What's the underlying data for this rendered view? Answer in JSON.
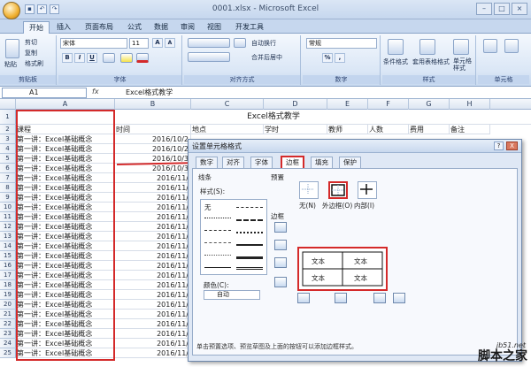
{
  "window": {
    "title": "0001.xlsx - Microsoft Excel"
  },
  "ribbon_tabs": [
    "开始",
    "插入",
    "页面布局",
    "公式",
    "数据",
    "审阅",
    "视图",
    "开发工具"
  ],
  "ribbon": {
    "clipboard": {
      "paste": "粘贴",
      "cut": "剪切",
      "copy": "复制",
      "format_painter": "格式刷",
      "label": "剪贴板"
    },
    "font": {
      "name": "宋体",
      "size": "11",
      "bold": "B",
      "italic": "I",
      "underline": "U",
      "grow": "A",
      "shrink": "A",
      "label": "字体"
    },
    "alignment": {
      "wrap": "自动换行",
      "merge": "合并后居中",
      "label": "对齐方式"
    },
    "number": {
      "format": "常规",
      "percent": "%",
      "comma": ",",
      "label": "数字"
    },
    "styles": {
      "conditional": "条件格式",
      "table": "套用表格格式",
      "cell_styles": "单元格样式",
      "label": "样式"
    },
    "cells": {
      "label": "单元格"
    }
  },
  "formula_bar": {
    "name_box": "A1",
    "fx": "fx",
    "content": "Excel格式教学"
  },
  "sheet": {
    "columns": [
      "A",
      "B",
      "C",
      "D",
      "E",
      "F",
      "G",
      "H"
    ],
    "title": "Excel格式教学",
    "headers": [
      "课程",
      "时间",
      "地点",
      "学时",
      "教师",
      "人数",
      "费用",
      "备注"
    ],
    "row_numbers": [
      "1",
      "2",
      "3",
      "4",
      "5",
      "6",
      "7",
      "8",
      "9",
      "10",
      "11",
      "12",
      "13",
      "14",
      "15",
      "16",
      "17",
      "18",
      "19",
      "20",
      "21",
      "22",
      "23",
      "24",
      "25"
    ],
    "rows": [
      [
        "第一讲：Excel基础概念",
        "2016/10/2"
      ],
      [
        "第一讲：Excel基础概念",
        "2016/10/2"
      ],
      [
        "第一讲：Excel基础概念",
        "2016/10/3"
      ],
      [
        "第一讲：Excel基础概念",
        "2016/10/3"
      ],
      [
        "第一讲：Excel基础概念",
        "2016/11/"
      ],
      [
        "第一讲：Excel基础概念",
        "2016/11/"
      ],
      [
        "第一讲：Excel基础概念",
        "2016/11/"
      ],
      [
        "第一讲：Excel基础概念",
        "2016/11/"
      ],
      [
        "第一讲：Excel基础概念",
        "2016/11/"
      ],
      [
        "第一讲：Excel基础概念",
        "2016/11/"
      ],
      [
        "第一讲：Excel基础概念",
        "2016/11/"
      ],
      [
        "第一讲：Excel基础概念",
        "2016/11/"
      ],
      [
        "第一讲：Excel基础概念",
        "2016/11/"
      ],
      [
        "第一讲：Excel基础概念",
        "2016/11/"
      ],
      [
        "第一讲：Excel基础概念",
        "2016/11/"
      ],
      [
        "第一讲：Excel基础概念",
        "2016/11/"
      ],
      [
        "第一讲：Excel基础概念",
        "2016/11/"
      ],
      [
        "第一讲：Excel基础概念",
        "2016/11/"
      ],
      [
        "第一讲：Excel基础概念",
        "2016/11/"
      ],
      [
        "第一讲：Excel基础概念",
        "2016/11/"
      ],
      [
        "第一讲：Excel基础概念",
        "2016/11/"
      ],
      [
        "第一讲：Excel基础概念",
        "2016/11/"
      ],
      [
        "第一讲：Excel基础概念",
        "2016/11/"
      ]
    ]
  },
  "dialog": {
    "title": "设置单元格格式",
    "help": "?",
    "close": "X",
    "tabs": [
      "数字",
      "对齐",
      "字体",
      "边框",
      "填充",
      "保护"
    ],
    "active_tab": "边框",
    "line_label": "线条",
    "style_label": "样式(S):",
    "none_style": "无",
    "color_label": "颜色(C):",
    "color_value": "自动",
    "presets_label": "预置",
    "preset_none": "无(N)",
    "preset_outline": "外边框(O)",
    "preset_inside": "内部(I)",
    "border_label": "边框",
    "preview_text": "文本",
    "note": "单击预置选项、预览草图及上面的按钮可以添加边框样式。"
  },
  "colors": {
    "highlight": "#d42a2a",
    "ribbon": "#c6d7ee"
  },
  "watermark": {
    "site": "jb51.net",
    "name": "脚本之家"
  }
}
